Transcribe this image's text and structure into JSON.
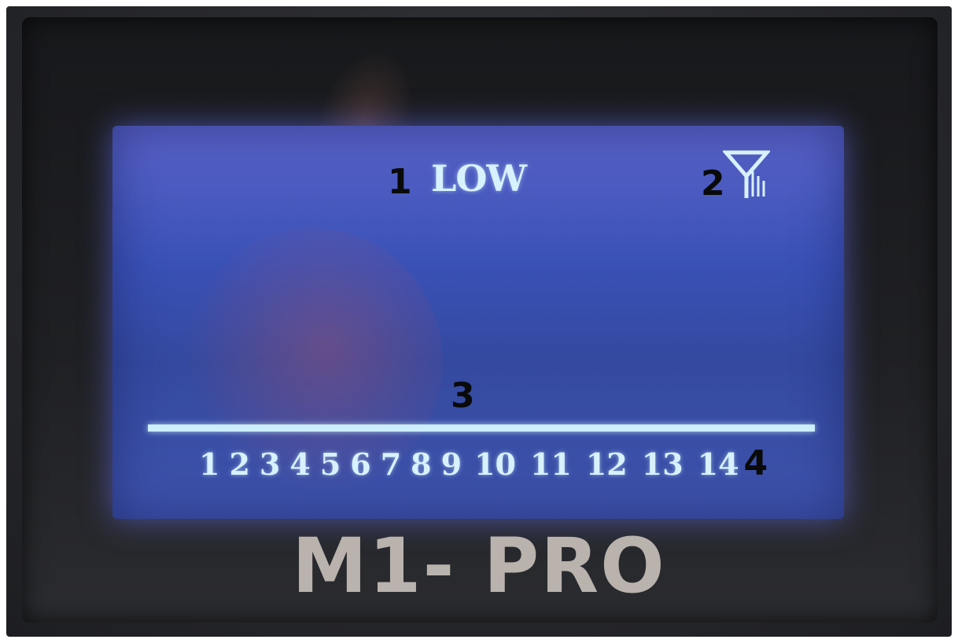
{
  "screen": {
    "level_label": "LOW",
    "icon": "signal-level-icon",
    "channels": [
      "1",
      "2",
      "3",
      "4",
      "5",
      "6",
      "7",
      "8",
      "9",
      "10",
      "11",
      "12",
      "13",
      "14"
    ]
  },
  "annotations": {
    "level": "1",
    "icon": "2",
    "bar": "3",
    "channels": "4"
  },
  "device": {
    "model": "M1- PRO"
  },
  "colors": {
    "screen_background": "#3a51b6",
    "display_text": "#d8f1ff",
    "bezel": "#1f2023",
    "brand_text": "#b9b2ad"
  }
}
